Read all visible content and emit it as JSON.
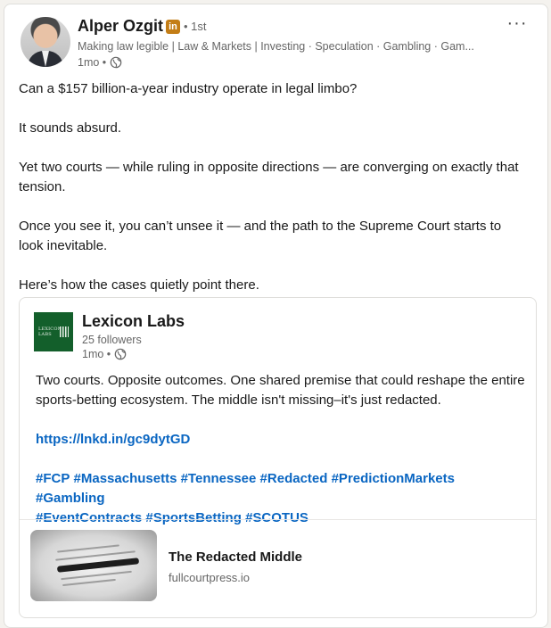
{
  "author": {
    "name": "Alper Ozgit",
    "badge": "in",
    "degree": "• 1st",
    "headline": "Making law legible | Law & Markets | Investing · Speculation · Gambling · Gam...",
    "time": "1mo •",
    "more_label": "···"
  },
  "post": {
    "paragraphs": [
      "Can a $157 billion-a-year industry operate in legal limbo?",
      "It sounds absurd.",
      "Yet two courts — while ruling in opposite directions — are converging on exactly that tension.",
      "Once you see it, you can’t unsee it — and the path to the Supreme Court starts to look inevitable.",
      "Here’s how the cases quietly point there."
    ]
  },
  "reshare": {
    "org_name": "Lexicon Labs",
    "logo_text": "LEXICON LABS",
    "followers": "25 followers",
    "time": "1mo •",
    "text": "Two courts. Opposite outcomes. One shared premise that could reshape the entire sports-betting ecosystem. The middle isn't missing–it's just redacted.",
    "link": "https://lnkd.in/gc9dytGD",
    "hashtags": [
      "#FCP",
      "#Massachusetts",
      "#Tennessee",
      "#Redacted",
      "#PredictionMarkets",
      "#Gambling",
      "#EventContracts",
      "#SportsBetting",
      "#SCOTUS"
    ]
  },
  "article": {
    "title": "The Redacted Middle",
    "domain": "fullcourtpress.io"
  },
  "colors": {
    "link": "#0a66c2",
    "badge": "#c37d16",
    "logo_bg": "#135f2b"
  }
}
